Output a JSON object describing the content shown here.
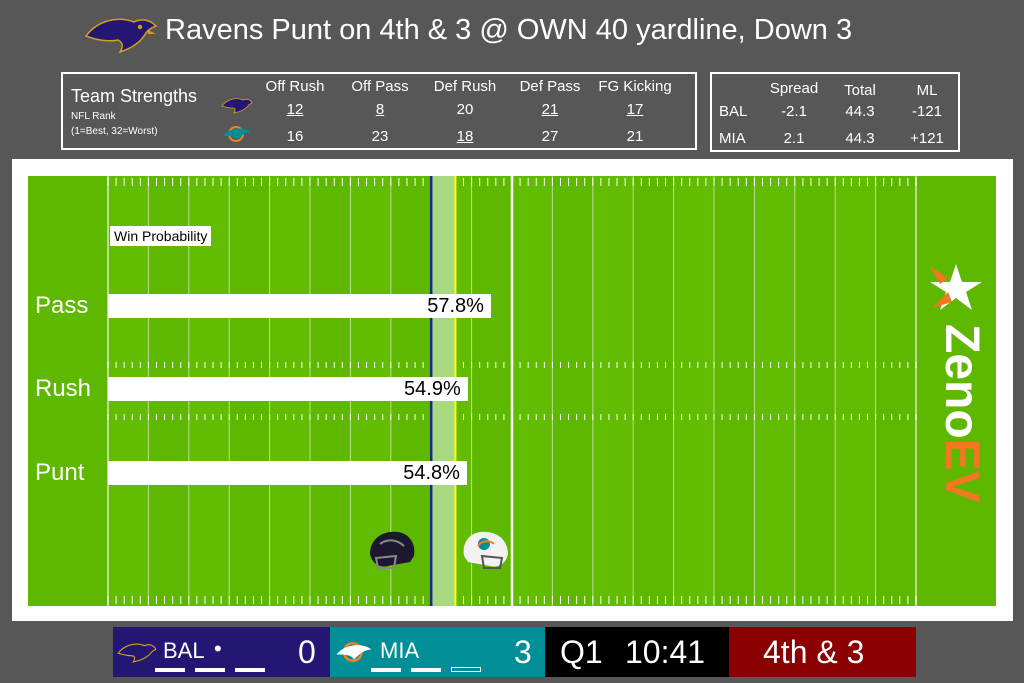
{
  "header": {
    "title": "Ravens Punt on 4th & 3 @ OWN 40 yardline, Down 3"
  },
  "strengths": {
    "title": "Team Strengths",
    "sub1": "NFL Rank",
    "sub2": "(1=Best, 32=Worst)",
    "columns": [
      "Off Rush",
      "Off Pass",
      "Def Rush",
      "Def Pass",
      "FG Kicking"
    ],
    "rows": [
      {
        "team": "BAL",
        "values": [
          "12",
          "8",
          "20",
          "21",
          "17"
        ],
        "underlined": [
          true,
          true,
          false,
          true,
          true
        ]
      },
      {
        "team": "MIA",
        "values": [
          "16",
          "23",
          "18",
          "27",
          "21"
        ],
        "underlined": [
          false,
          false,
          true,
          false,
          false
        ]
      }
    ]
  },
  "odds": {
    "columns": [
      "Spread",
      "Total",
      "ML"
    ],
    "rows": [
      {
        "team": "BAL",
        "values": [
          "-2.1",
          "44.3",
          "-121"
        ]
      },
      {
        "team": "MIA",
        "values": [
          "2.1",
          "44.3",
          "+121"
        ]
      }
    ]
  },
  "chart_data": {
    "type": "bar",
    "title": "Win Probability",
    "categories": [
      "Pass",
      "Rush",
      "Punt"
    ],
    "values": [
      57.8,
      54.9,
      54.8
    ],
    "value_labels": [
      "57.8%",
      "54.9%",
      "54.8%"
    ],
    "unit": "%",
    "orientation": "horizontal"
  },
  "field": {
    "brand": "ZenoEV",
    "brand_part1": "Zeno",
    "brand_part2": "EV",
    "colors": {
      "turf": "#5eb800",
      "scrimmage": "#1a2a8c",
      "first_down": "#ffff00",
      "brand_orange": "#f07820"
    }
  },
  "scoreboard": {
    "home": {
      "abbr": "BAL",
      "score": "0",
      "possession": "•",
      "color": "#241773"
    },
    "away": {
      "abbr": "MIA",
      "score": "3",
      "color": "#008e97"
    },
    "quarter": "Q1",
    "clock": "10:41",
    "down_distance": "4th & 3",
    "down_color": "#8b0000"
  }
}
